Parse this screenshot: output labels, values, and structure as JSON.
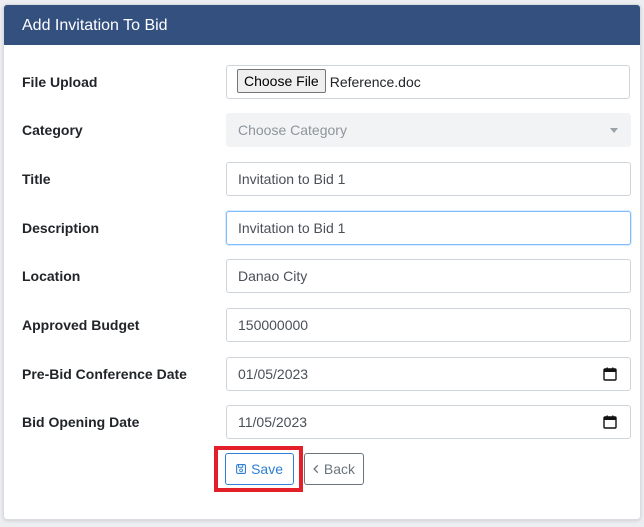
{
  "header": {
    "title": "Add Invitation To Bid"
  },
  "form": {
    "file_upload": {
      "label": "File Upload",
      "button": "Choose File",
      "file_name": "Reference.doc"
    },
    "category": {
      "label": "Category",
      "placeholder": "Choose Category"
    },
    "title": {
      "label": "Title",
      "value": "Invitation to Bid 1"
    },
    "description": {
      "label": "Description",
      "value": "Invitation to Bid 1"
    },
    "location": {
      "label": "Location",
      "value": "Danao City"
    },
    "approved_budget": {
      "label": "Approved Budget",
      "value": "150000000"
    },
    "pre_bid_date": {
      "label": "Pre-Bid Conference Date",
      "value": "01/05/2023"
    },
    "bid_opening_date": {
      "label": "Bid Opening Date",
      "value": "11/05/2023"
    }
  },
  "actions": {
    "save_label": "Save",
    "back_label": "Back"
  },
  "colors": {
    "header_bg": "#33507f",
    "primary": "#2e7ed6",
    "secondary": "#6c757d",
    "highlight": "#e3202a"
  },
  "icons": {
    "save": "floppy-disk-icon",
    "back": "chevron-left-icon",
    "calendar": "calendar-icon",
    "dropdown": "caret-down-icon"
  }
}
